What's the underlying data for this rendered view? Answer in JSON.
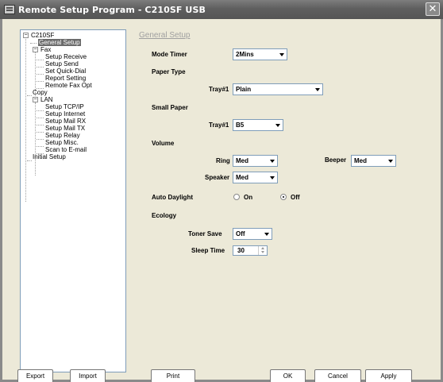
{
  "window": {
    "title": "Remote Setup Program - C210SF USB"
  },
  "tree": {
    "items": [
      {
        "label": "C210SF"
      },
      {
        "label": "General Setup"
      },
      {
        "label": "Fax"
      },
      {
        "label": "Setup Receive"
      },
      {
        "label": "Setup Send"
      },
      {
        "label": "Set Quick-Dial"
      },
      {
        "label": "Report Setting"
      },
      {
        "label": "Remote Fax Opt"
      },
      {
        "label": "Copy"
      },
      {
        "label": "LAN"
      },
      {
        "label": "Setup TCP/IP"
      },
      {
        "label": "Setup Internet"
      },
      {
        "label": "Setup Mail RX"
      },
      {
        "label": "Setup Mail TX"
      },
      {
        "label": "Setup Relay"
      },
      {
        "label": "Setup Misc."
      },
      {
        "label": "Scan to E-mail"
      },
      {
        "label": "Initial Setup"
      }
    ],
    "selected": "General Setup"
  },
  "panel": {
    "title": "General Setup",
    "mode_timer": {
      "label": "Mode Timer",
      "value": "2Mins"
    },
    "paper_type": {
      "label": "Paper Type",
      "tray_label": "Tray#1",
      "value": "Plain"
    },
    "small_paper": {
      "label": "Small Paper",
      "tray_label": "Tray#1",
      "value": "B5"
    },
    "volume": {
      "label": "Volume",
      "ring_label": "Ring",
      "ring_value": "Med",
      "beeper_label": "Beeper",
      "beeper_value": "Med",
      "speaker_label": "Speaker",
      "speaker_value": "Med"
    },
    "auto_daylight": {
      "label": "Auto Daylight",
      "on_label": "On",
      "off_label": "Off",
      "selected": "Off"
    },
    "ecology": {
      "label": "Ecology",
      "toner_save_label": "Toner Save",
      "toner_save_value": "Off",
      "sleep_time_label": "Sleep Time",
      "sleep_time_value": "30"
    }
  },
  "buttons": {
    "export": "Export",
    "import": "Import",
    "print": "Print",
    "ok": "OK",
    "cancel": "Cancel",
    "apply": "Apply"
  }
}
